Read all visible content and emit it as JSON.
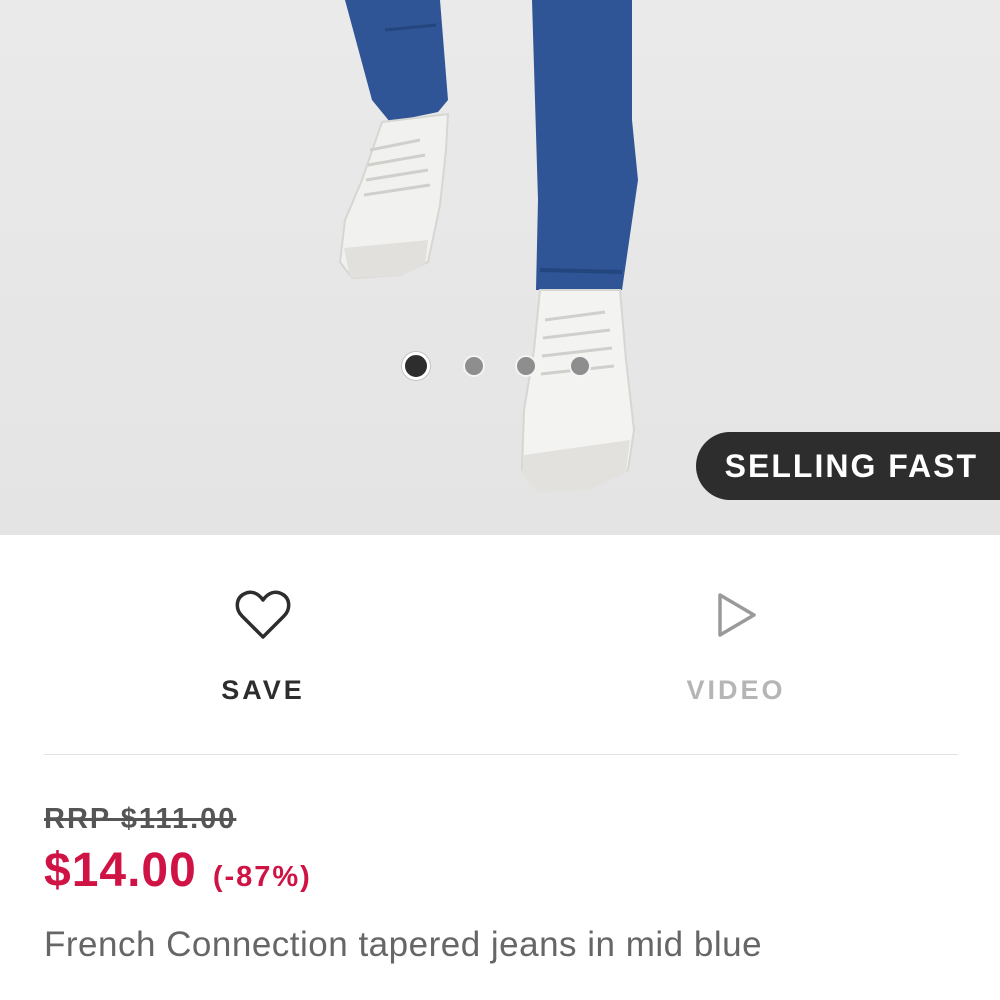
{
  "product_image": {
    "description_icon": "product-photo",
    "carousel": {
      "total": 4,
      "active_index": 0
    },
    "badge": "SELLING FAST"
  },
  "actions": {
    "save_label": "SAVE",
    "save_icon": "heart-icon",
    "video_label": "VIDEO",
    "video_icon": "play-icon"
  },
  "pricing": {
    "rrp": "RRP $111.00",
    "price": "$14.00",
    "discount": "(-87%)",
    "accent_color": "#d01345"
  },
  "product": {
    "title": "French Connection tapered jeans in mid blue"
  }
}
